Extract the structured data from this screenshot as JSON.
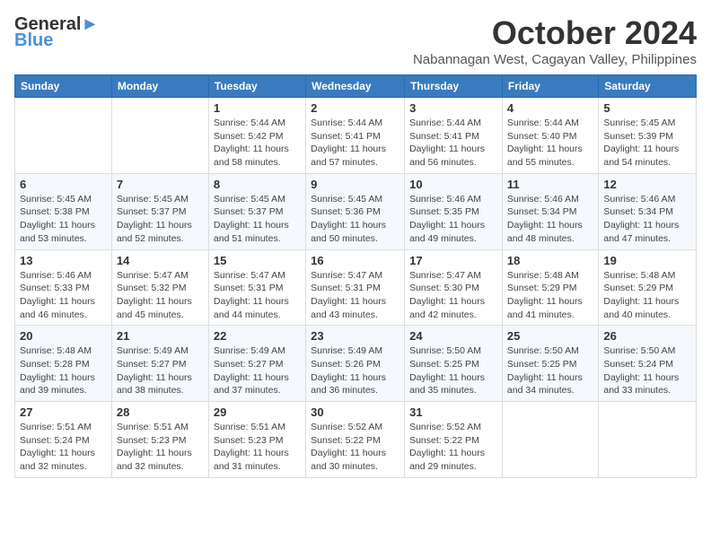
{
  "logo": {
    "line1": "General",
    "line2": "Blue"
  },
  "title": "October 2024",
  "location": "Nabannagan West, Cagayan Valley, Philippines",
  "headers": [
    "Sunday",
    "Monday",
    "Tuesday",
    "Wednesday",
    "Thursday",
    "Friday",
    "Saturday"
  ],
  "weeks": [
    [
      {
        "day": "",
        "info": ""
      },
      {
        "day": "",
        "info": ""
      },
      {
        "day": "1",
        "info": "Sunrise: 5:44 AM\nSunset: 5:42 PM\nDaylight: 11 hours and 58 minutes."
      },
      {
        "day": "2",
        "info": "Sunrise: 5:44 AM\nSunset: 5:41 PM\nDaylight: 11 hours and 57 minutes."
      },
      {
        "day": "3",
        "info": "Sunrise: 5:44 AM\nSunset: 5:41 PM\nDaylight: 11 hours and 56 minutes."
      },
      {
        "day": "4",
        "info": "Sunrise: 5:44 AM\nSunset: 5:40 PM\nDaylight: 11 hours and 55 minutes."
      },
      {
        "day": "5",
        "info": "Sunrise: 5:45 AM\nSunset: 5:39 PM\nDaylight: 11 hours and 54 minutes."
      }
    ],
    [
      {
        "day": "6",
        "info": "Sunrise: 5:45 AM\nSunset: 5:38 PM\nDaylight: 11 hours and 53 minutes."
      },
      {
        "day": "7",
        "info": "Sunrise: 5:45 AM\nSunset: 5:37 PM\nDaylight: 11 hours and 52 minutes."
      },
      {
        "day": "8",
        "info": "Sunrise: 5:45 AM\nSunset: 5:37 PM\nDaylight: 11 hours and 51 minutes."
      },
      {
        "day": "9",
        "info": "Sunrise: 5:45 AM\nSunset: 5:36 PM\nDaylight: 11 hours and 50 minutes."
      },
      {
        "day": "10",
        "info": "Sunrise: 5:46 AM\nSunset: 5:35 PM\nDaylight: 11 hours and 49 minutes."
      },
      {
        "day": "11",
        "info": "Sunrise: 5:46 AM\nSunset: 5:34 PM\nDaylight: 11 hours and 48 minutes."
      },
      {
        "day": "12",
        "info": "Sunrise: 5:46 AM\nSunset: 5:34 PM\nDaylight: 11 hours and 47 minutes."
      }
    ],
    [
      {
        "day": "13",
        "info": "Sunrise: 5:46 AM\nSunset: 5:33 PM\nDaylight: 11 hours and 46 minutes."
      },
      {
        "day": "14",
        "info": "Sunrise: 5:47 AM\nSunset: 5:32 PM\nDaylight: 11 hours and 45 minutes."
      },
      {
        "day": "15",
        "info": "Sunrise: 5:47 AM\nSunset: 5:31 PM\nDaylight: 11 hours and 44 minutes."
      },
      {
        "day": "16",
        "info": "Sunrise: 5:47 AM\nSunset: 5:31 PM\nDaylight: 11 hours and 43 minutes."
      },
      {
        "day": "17",
        "info": "Sunrise: 5:47 AM\nSunset: 5:30 PM\nDaylight: 11 hours and 42 minutes."
      },
      {
        "day": "18",
        "info": "Sunrise: 5:48 AM\nSunset: 5:29 PM\nDaylight: 11 hours and 41 minutes."
      },
      {
        "day": "19",
        "info": "Sunrise: 5:48 AM\nSunset: 5:29 PM\nDaylight: 11 hours and 40 minutes."
      }
    ],
    [
      {
        "day": "20",
        "info": "Sunrise: 5:48 AM\nSunset: 5:28 PM\nDaylight: 11 hours and 39 minutes."
      },
      {
        "day": "21",
        "info": "Sunrise: 5:49 AM\nSunset: 5:27 PM\nDaylight: 11 hours and 38 minutes."
      },
      {
        "day": "22",
        "info": "Sunrise: 5:49 AM\nSunset: 5:27 PM\nDaylight: 11 hours and 37 minutes."
      },
      {
        "day": "23",
        "info": "Sunrise: 5:49 AM\nSunset: 5:26 PM\nDaylight: 11 hours and 36 minutes."
      },
      {
        "day": "24",
        "info": "Sunrise: 5:50 AM\nSunset: 5:25 PM\nDaylight: 11 hours and 35 minutes."
      },
      {
        "day": "25",
        "info": "Sunrise: 5:50 AM\nSunset: 5:25 PM\nDaylight: 11 hours and 34 minutes."
      },
      {
        "day": "26",
        "info": "Sunrise: 5:50 AM\nSunset: 5:24 PM\nDaylight: 11 hours and 33 minutes."
      }
    ],
    [
      {
        "day": "27",
        "info": "Sunrise: 5:51 AM\nSunset: 5:24 PM\nDaylight: 11 hours and 32 minutes."
      },
      {
        "day": "28",
        "info": "Sunrise: 5:51 AM\nSunset: 5:23 PM\nDaylight: 11 hours and 32 minutes."
      },
      {
        "day": "29",
        "info": "Sunrise: 5:51 AM\nSunset: 5:23 PM\nDaylight: 11 hours and 31 minutes."
      },
      {
        "day": "30",
        "info": "Sunrise: 5:52 AM\nSunset: 5:22 PM\nDaylight: 11 hours and 30 minutes."
      },
      {
        "day": "31",
        "info": "Sunrise: 5:52 AM\nSunset: 5:22 PM\nDaylight: 11 hours and 29 minutes."
      },
      {
        "day": "",
        "info": ""
      },
      {
        "day": "",
        "info": ""
      }
    ]
  ]
}
